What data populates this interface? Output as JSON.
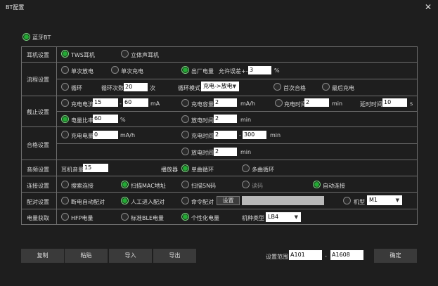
{
  "window": {
    "title": "BT配置",
    "close_glyph": "✕"
  },
  "bt_toggle": {
    "label": "蓝牙BT",
    "on": true
  },
  "rows": {
    "earphone": {
      "label": "耳机设置",
      "opt1": "TWS耳机",
      "opt2": "立体声耳机"
    },
    "process": {
      "label": "流程设置",
      "single_discharge": "单次放电",
      "single_charge": "单次充电",
      "factory_power": "出厂电量",
      "allowed_error": "允许误差+-",
      "allowed_error_value": "3",
      "percent": "%",
      "loop": "循环",
      "loop_count_label": "循环次数",
      "loop_count_value": "20",
      "times_unit": "次",
      "loop_mode_label": "循环模式",
      "loop_mode_value": "充电->放电",
      "first_pass": "首次合格",
      "last_charge": "最后充电"
    },
    "cutoff": {
      "label": "截止设置",
      "charge_current": "充电电流",
      "cc_min": "15",
      "cc_sep": "-",
      "cc_max": "60",
      "ma": "mA",
      "charge_capacity": "充电容量",
      "charge_capacity_value": "2",
      "mah": "mA/h",
      "charge_time": "充电时间",
      "charge_time_value": "2",
      "min": "min",
      "delay_time": "延时时间",
      "delay_time_value": "10",
      "s": "s",
      "power_ratio": "电量比率",
      "power_ratio_value": "60",
      "percent": "%",
      "discharge_time": "放电时间",
      "discharge_time_value": "2",
      "min2": "min"
    },
    "pass": {
      "label": "合格设置",
      "charge_power": "充电电量",
      "charge_power_value": "0",
      "mah": "mA/h",
      "charge_time": "充电时间",
      "ct_min": "2",
      "ct_sep": "-",
      "ct_max": "300",
      "min": "min",
      "discharge_time": "放电时间",
      "discharge_time_value": "2",
      "min2": "min"
    },
    "audio": {
      "label": "音频设置",
      "volume_label": "耳机音量",
      "volume_value": "15",
      "player_label": "播放器",
      "single_loop": "单曲循环",
      "multi_loop": "多曲循环"
    },
    "connect": {
      "label": "连接设置",
      "search": "搜索连接",
      "scan_mac": "扫描MAC地址",
      "scan_sn": "扫描SN码",
      "read_code": "读码",
      "auto_connect": "自动连接"
    },
    "pair": {
      "label": "配对设置",
      "disconnect_pair": "断电自动配对",
      "manual_pair": "人工进入配对",
      "cmd_pair": "命令配对",
      "set_btn": "设置",
      "model_label": "机型",
      "model_value": "M1"
    },
    "power": {
      "label": "电量获取",
      "hfp": "HFP电量",
      "ble": "标准BLE电量",
      "custom": "个性化电量",
      "type_label": "机种类型",
      "type_value": "LB4"
    }
  },
  "footer": {
    "copy": "复制",
    "paste": "粘贴",
    "import": "导入",
    "export": "导出",
    "range_label": "设置范围",
    "range_from": "A101",
    "range_sep": "-",
    "range_to": "A1608",
    "ok": "确定"
  },
  "colors": {
    "on": "#22aa33",
    "bg": "#1e1e1e",
    "line": "#6d6d6d"
  }
}
